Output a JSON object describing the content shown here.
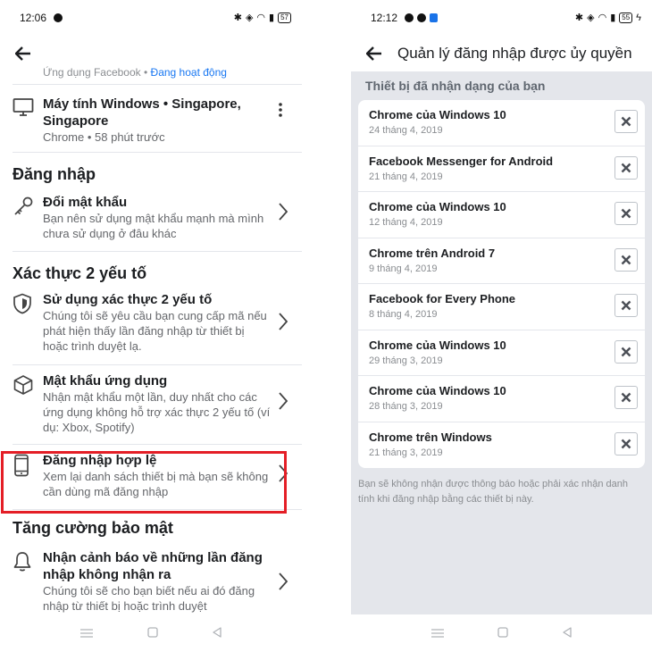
{
  "left": {
    "status": {
      "time": "12:06",
      "battery": "57"
    },
    "faded_prefix": "Ứng dụng Facebook • ",
    "faded_link": "Đang hoạt động",
    "windows_session": {
      "title": "Máy tính Windows • Singapore, Singapore",
      "sub": "Chrome • 58 phút trước"
    },
    "section_login": "Đăng nhập",
    "change_password": {
      "title": "Đổi mật khẩu",
      "sub": "Bạn nên sử dụng mật khẩu mạnh mà mình chưa sử dụng ở đâu khác"
    },
    "section_2fa": "Xác thực 2 yếu tố",
    "use_2fa": {
      "title": "Sử dụng xác thực 2 yếu tố",
      "sub": "Chúng tôi sẽ yêu cầu bạn cung cấp mã nếu phát hiện thấy lần đăng nhập từ thiết bị hoặc trình duyệt lạ."
    },
    "app_passwords": {
      "title": "Mật khẩu ứng dụng",
      "sub": "Nhận mật khẩu một lần, duy nhất cho các ứng dụng không hỗ trợ xác thực 2 yếu tố (ví dụ: Xbox, Spotify)"
    },
    "authorized_logins": {
      "title": "Đăng nhập hợp lệ",
      "sub": "Xem lại danh sách thiết bị mà bạn sẽ không cần dùng mã đăng nhập"
    },
    "section_extra": "Tăng cường bảo mật",
    "alerts": {
      "title": "Nhận cảnh báo về những lần đăng nhập không nhận ra",
      "sub": "Chúng tôi sẽ cho bạn biết nếu ai đó đăng nhập từ thiết bị hoặc trình duyệt"
    }
  },
  "right": {
    "status": {
      "time": "12:12",
      "battery": "55"
    },
    "title": "Quản lý đăng nhập được ủy quyền",
    "section_label": "Thiết bị đã nhận dạng của bạn",
    "devices": [
      {
        "name": "Chrome của Windows 10",
        "date": "24 tháng 4, 2019"
      },
      {
        "name": "Facebook Messenger for Android",
        "date": "21 tháng 4, 2019"
      },
      {
        "name": "Chrome của Windows 10",
        "date": "12 tháng 4, 2019"
      },
      {
        "name": "Chrome trên Android 7",
        "date": "9 tháng 4, 2019"
      },
      {
        "name": "Facebook for Every Phone",
        "date": "8 tháng 4, 2019"
      },
      {
        "name": "Chrome của Windows 10",
        "date": "29 tháng 3, 2019"
      },
      {
        "name": "Chrome của Windows 10",
        "date": "28 tháng 3, 2019"
      },
      {
        "name": "Chrome trên Windows",
        "date": "21 tháng 3, 2019"
      }
    ],
    "note": "Bạn sẽ không nhận được thông báo hoặc phải xác nhận danh tính khi đăng nhập bằng các thiết bị này."
  },
  "icons": [
    "back-arrow-icon",
    "monitor-icon",
    "key-icon",
    "shield-icon",
    "cube-icon",
    "phone-icon",
    "bell-icon",
    "chevron-right-icon",
    "more-vertical-icon",
    "close-icon"
  ],
  "colors": {
    "highlight": "#e41e26",
    "link": "#1877f2",
    "panel_bg": "#e4e6eb"
  }
}
